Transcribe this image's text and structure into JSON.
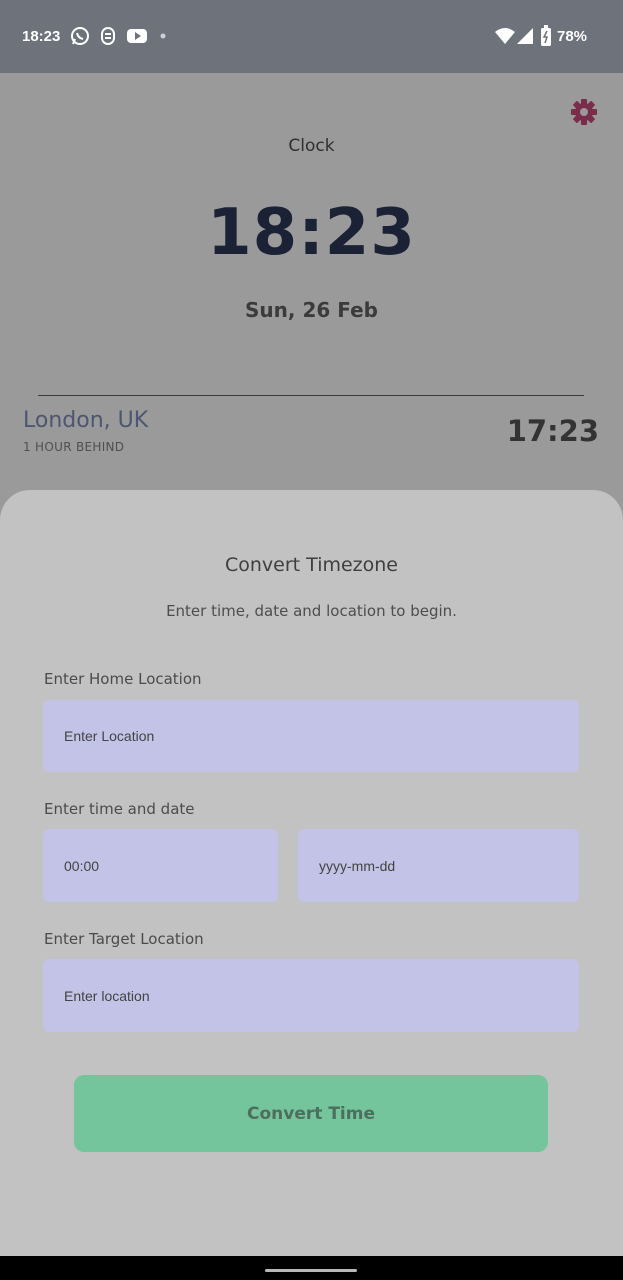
{
  "status_bar": {
    "time": "18:23",
    "battery": "78%",
    "icons": [
      "whatsapp-icon",
      "signal-app-icon",
      "youtube-icon",
      "dot-icon",
      "wifi-icon",
      "cell-signal-icon",
      "battery-icon"
    ]
  },
  "clock": {
    "title": "Clock",
    "time": "18:23",
    "date": "Sun, 26 Feb"
  },
  "world_clock": {
    "city": "London, UK",
    "offset": "1 HOUR BEHIND",
    "time": "17:23"
  },
  "sheet": {
    "title": "Convert Timezone",
    "subtitle": "Enter time, date and location to begin.",
    "home_label": "Enter Home Location",
    "home_placeholder": "Enter Location",
    "datetime_label": "Enter time and date",
    "time_placeholder": "00:00",
    "date_placeholder": "yyyy-mm-dd",
    "target_label": "Enter Target Location",
    "target_placeholder": "Enter location",
    "button_label": "Convert Time"
  },
  "colors": {
    "accent_gear": "#7a2d4a",
    "input_bg": "#c3c3e7",
    "button_bg": "#74c59c"
  }
}
